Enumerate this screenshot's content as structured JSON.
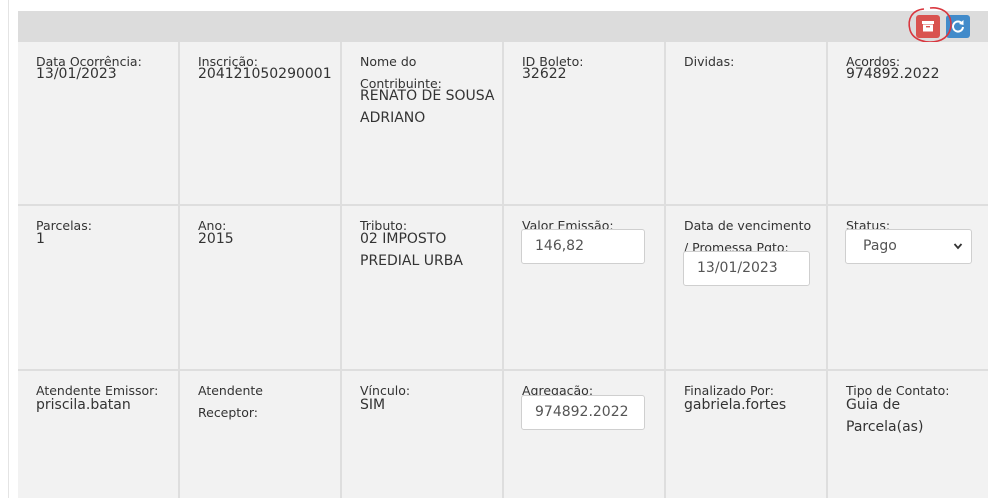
{
  "toolbar": {
    "archive_icon": "archive-icon",
    "refresh_icon": "refresh-icon",
    "annotation_color": "#d9363e"
  },
  "rows": [
    [
      {
        "label": "Data Ocorrência:",
        "value": "13/01/2023"
      },
      {
        "label": "Inscrição:",
        "value": "204121050290001"
      },
      {
        "label": "Nome do Contribuinte:",
        "value": "RENATO DE SOUSA ADRIANO"
      },
      {
        "label": "ID Boleto:",
        "value": "32622"
      },
      {
        "label": "Dividas:",
        "value": ""
      },
      {
        "label": "Acordos:",
        "value": "974892.2022"
      }
    ],
    [
      {
        "label": "Parcelas:",
        "value": "1"
      },
      {
        "label": "Ano:",
        "value": "2015"
      },
      {
        "label": "Tributo:",
        "value": "02 IMPOSTO PREDIAL URBA"
      },
      {
        "label": "Valor Emissão:",
        "input_value": "146,82"
      },
      {
        "label": "Data de vencimento / Promessa Pgto:",
        "input_value": "13/01/2023"
      },
      {
        "label": "Status:",
        "select_value": "Pago"
      }
    ],
    [
      {
        "label": "Atendente Emissor:",
        "value": "priscila.batan"
      },
      {
        "label": "Atendente Receptor:",
        "value": ""
      },
      {
        "label": "Vínculo:",
        "value": "SIM"
      },
      {
        "label": "Agregação:",
        "input_value": "974892.2022"
      },
      {
        "label": "Finalizado Por:",
        "value": "gabriela.fortes"
      },
      {
        "label": "Tipo de Contato:",
        "value": "Guia de Parcela(as)"
      }
    ]
  ]
}
